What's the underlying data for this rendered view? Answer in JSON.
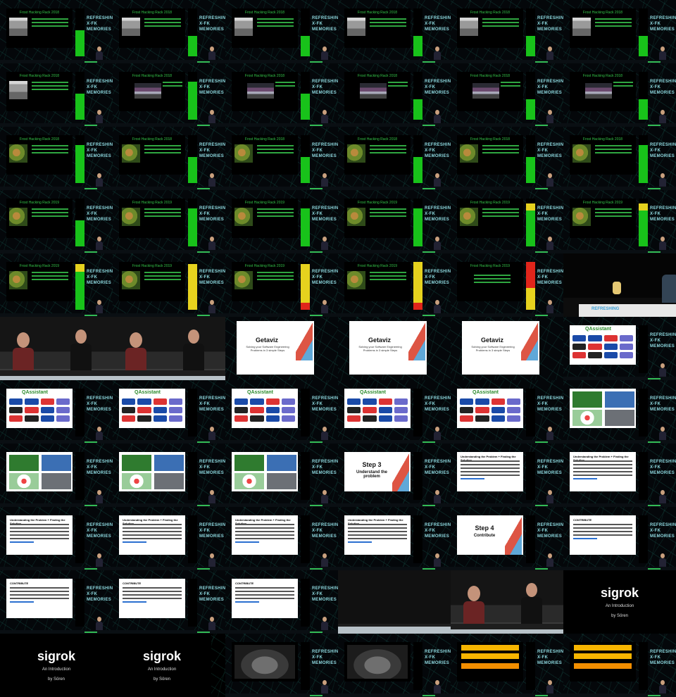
{
  "texts": {
    "ffb": "Frost Hacking Rack 2018",
    "ffb2": "Frost Hacking Rack 2019",
    "brand_l1": "REFRESHING",
    "brand_l2": "X-FK",
    "brand_l3": "MEMORIES",
    "getaviz": "Getaviz",
    "getaviz_sub": "Solving your Software Engineering Problems in 3 simple Steps",
    "qa": "QAssistant",
    "understand": "Understanding the Problem + Finding the Solution",
    "step3_title": "Step 3",
    "step3_sub": "Understand the problem",
    "step4_title": "Step 4",
    "step4_sub": "Contribute",
    "contribute": "CONTRIBUTE",
    "sigrok": "sigrok",
    "sigrok_sub": "An Introduction",
    "sigrok_by": "by Sören",
    "refreshing": "REFRESHING"
  },
  "colors": {
    "meter_green": "#18c21a",
    "meter_yellow": "#e6d21e",
    "meter_red": "#e0251b",
    "accent": "#34c54a"
  },
  "grid": {
    "rows": 11,
    "cols": 6
  },
  "tiles": [
    {
      "kind": "ffb",
      "pic": "mag",
      "level": 0.55,
      "mc": "green"
    },
    {
      "kind": "ffb",
      "pic": "mag",
      "level": 0.42,
      "mc": "green"
    },
    {
      "kind": "ffb",
      "pic": "mag",
      "level": 0.42,
      "mc": "green"
    },
    {
      "kind": "ffb",
      "pic": "mag",
      "level": 0.42,
      "mc": "green"
    },
    {
      "kind": "ffb",
      "pic": "mag",
      "level": 0.42,
      "mc": "green"
    },
    {
      "kind": "ffb",
      "pic": "mag",
      "level": 0.42,
      "mc": "green"
    },
    {
      "kind": "ffb",
      "pic": "mag",
      "level": 0.55,
      "mc": "green"
    },
    {
      "kind": "ffb",
      "pic": "crowd",
      "level": 0.8,
      "mc": "green"
    },
    {
      "kind": "ffb",
      "pic": "crowd",
      "level": 0.55,
      "mc": "green"
    },
    {
      "kind": "ffb",
      "pic": "crowd",
      "level": 0.42,
      "mc": "green"
    },
    {
      "kind": "ffb",
      "pic": "crowd",
      "level": 0.42,
      "mc": "green"
    },
    {
      "kind": "ffb",
      "pic": "crowd",
      "level": 0.42,
      "mc": "green"
    },
    {
      "kind": "ffb",
      "pic": "jungle",
      "level": 0.8,
      "mc": "green"
    },
    {
      "kind": "ffb",
      "pic": "jungle",
      "level": 0.55,
      "mc": "green"
    },
    {
      "kind": "ffb",
      "pic": "jungle",
      "level": 0.55,
      "mc": "green"
    },
    {
      "kind": "ffb",
      "pic": "jungle",
      "level": 0.55,
      "mc": "green"
    },
    {
      "kind": "ffb",
      "pic": "jungle",
      "level": 0.55,
      "mc": "green"
    },
    {
      "kind": "ffb",
      "pic": "jungle",
      "level": 0.8,
      "mc": "green"
    },
    {
      "kind": "ffb",
      "pic": "jungle",
      "level": 0.55,
      "mc": "green"
    },
    {
      "kind": "ffb",
      "pic": "jungle",
      "level": 0.8,
      "mc": "green"
    },
    {
      "kind": "ffb",
      "pic": "jungle",
      "level": 0.8,
      "mc": "green"
    },
    {
      "kind": "ffb",
      "pic": "jungle",
      "level": 0.8,
      "mc": "green"
    },
    {
      "kind": "ffb",
      "pic": "jungle",
      "level": 0.9,
      "mc": "green-yellow"
    },
    {
      "kind": "ffb",
      "pic": "jungle",
      "level": 0.9,
      "mc": "green-yellow"
    },
    {
      "kind": "ffb",
      "pic": "jungle",
      "level": 0.95,
      "mc": "green-yellow"
    },
    {
      "kind": "ffb",
      "pic": "jungle",
      "level": 0.95,
      "mc": "yellow"
    },
    {
      "kind": "ffb",
      "pic": "jungle",
      "level": 0.95,
      "mc": "yellow-red"
    },
    {
      "kind": "ffb",
      "pic": "jungle",
      "level": 1.0,
      "mc": "yellow-red"
    },
    {
      "kind": "ffb",
      "pic": "none",
      "level": 1.0,
      "mc": "yellow-red2"
    },
    {
      "kind": "podium"
    },
    {
      "kind": "cam"
    },
    {
      "kind": "cam"
    },
    {
      "kind": "getaviz"
    },
    {
      "kind": "getaviz"
    },
    {
      "kind": "getaviz"
    },
    {
      "kind": "qa"
    },
    {
      "kind": "qa"
    },
    {
      "kind": "qa"
    },
    {
      "kind": "qa"
    },
    {
      "kind": "qa"
    },
    {
      "kind": "qa"
    },
    {
      "kind": "quad"
    },
    {
      "kind": "quad"
    },
    {
      "kind": "quad"
    },
    {
      "kind": "quad"
    },
    {
      "kind": "step3"
    },
    {
      "kind": "doc"
    },
    {
      "kind": "doc"
    },
    {
      "kind": "doc"
    },
    {
      "kind": "doc"
    },
    {
      "kind": "doc"
    },
    {
      "kind": "doc"
    },
    {
      "kind": "step4"
    },
    {
      "kind": "contrib"
    },
    {
      "kind": "contrib"
    },
    {
      "kind": "contrib"
    },
    {
      "kind": "contrib"
    },
    {
      "kind": "stagecam"
    },
    {
      "kind": "cam"
    },
    {
      "kind": "sigrok"
    },
    {
      "kind": "sigrok"
    },
    {
      "kind": "sigrok2"
    },
    {
      "kind": "gear"
    },
    {
      "kind": "gear"
    },
    {
      "kind": "orange"
    },
    {
      "kind": "orange"
    }
  ]
}
